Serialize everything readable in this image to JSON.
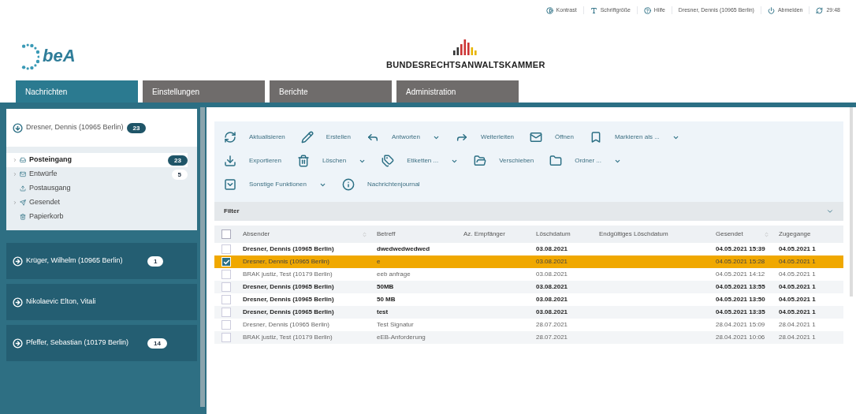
{
  "top_links": [
    {
      "kind": "contrast",
      "label": "Kontrast"
    },
    {
      "kind": "font",
      "label": "Schriftgröße"
    },
    {
      "kind": "help",
      "label": "Hilfe"
    },
    {
      "kind": "user",
      "label": "Dresner, Dennis (10965 Berlin)"
    },
    {
      "kind": "logout",
      "label": "Abmelden"
    },
    {
      "kind": "timer",
      "label": "29:48"
    }
  ],
  "logo": {
    "text": "beA"
  },
  "brand": {
    "text": "BUNDESRECHTSANWALTSKAMMER"
  },
  "tabs": [
    {
      "label": "Nachrichten",
      "selected": true
    },
    {
      "label": "Einstellungen",
      "selected": false
    },
    {
      "label": "Berichte",
      "selected": false
    },
    {
      "label": "Administration",
      "selected": false
    }
  ],
  "accounts": [
    {
      "name": "Dresner, Dennis (10965 Berlin)",
      "count": "23",
      "expanded": true,
      "folders": [
        {
          "kind": "inbox",
          "label": "Posteingang",
          "selected": true,
          "expandable": true,
          "count": "23"
        },
        {
          "kind": "drafts",
          "label": "Entwürfe",
          "selected": false,
          "expandable": true,
          "count": "5"
        },
        {
          "kind": "outbox",
          "label": "Postausgang",
          "selected": false,
          "expandable": false
        },
        {
          "kind": "sent",
          "label": "Gesendet",
          "selected": false,
          "expandable": true
        },
        {
          "kind": "trash",
          "label": "Papierkorb",
          "selected": false,
          "expandable": false
        }
      ]
    },
    {
      "name": "Krüger, Wilhelm (10965 Berlin)",
      "count": "1",
      "expanded": false
    },
    {
      "name": "Nikolaevic Elton, Vitali",
      "expanded": false
    },
    {
      "name": "Pfeffer, Sebastian (10179 Berlin)",
      "count": "14",
      "expanded": false
    }
  ],
  "toolbar": [
    [
      {
        "kind": "refresh",
        "label": "Aktualisieren",
        "dropdown": false
      },
      {
        "kind": "create",
        "label": "Erstellen",
        "dropdown": false
      },
      {
        "kind": "reply",
        "label": "Antworten",
        "dropdown": true
      },
      {
        "kind": "forward",
        "label": "Weiterleiten",
        "dropdown": false
      },
      {
        "kind": "open",
        "label": "Öffnen",
        "dropdown": false
      },
      {
        "kind": "mark",
        "label": "Markieren als ...",
        "dropdown": true
      }
    ],
    [
      {
        "kind": "export",
        "label": "Exportieren",
        "dropdown": false
      },
      {
        "kind": "delete",
        "label": "Löschen",
        "dropdown": true
      },
      {
        "kind": "labels",
        "label": "Etiketten ...",
        "dropdown": true
      },
      {
        "kind": "move",
        "label": "Verschieben",
        "dropdown": false
      },
      {
        "kind": "folder",
        "label": "Ordner ...",
        "dropdown": true
      }
    ],
    [
      {
        "kind": "more",
        "label": "Sonstige Funktionen",
        "dropdown": true
      },
      {
        "kind": "journal",
        "label": "Nachrichtenjournal",
        "dropdown": false
      }
    ]
  ],
  "filter": {
    "label": "Filter"
  },
  "table": {
    "select_all": {
      "checked": false
    },
    "columns": [
      {
        "label": "Absender",
        "sortable": true
      },
      {
        "label": "Betreff",
        "sortable": false
      },
      {
        "label": "Az. Empfänger",
        "sortable": false
      },
      {
        "label": "Löschdatum",
        "sortable": false
      },
      {
        "label": "Endgültiges Löschdatum",
        "sortable": false
      },
      {
        "label": "Gesendet",
        "sortable": true
      },
      {
        "label": "Zugegange",
        "sortable": false
      }
    ],
    "rows": [
      {
        "selected": false,
        "unread": true,
        "cells": [
          "Dresner, Dennis (10965 Berlin)",
          "dwedwedwedwed",
          "",
          "03.08.2021",
          "",
          "04.05.2021 15:39",
          "04.05.2021 1"
        ]
      },
      {
        "selected": true,
        "unread": false,
        "cells": [
          "Dresner, Dennis (10965 Berlin)",
          "e",
          "",
          "03.08.2021",
          "",
          "04.05.2021 15:28",
          "04.05.2021 1"
        ]
      },
      {
        "selected": false,
        "unread": false,
        "cells": [
          "BRAK justiz, Test (10179 Berlin)",
          "eeb anfrage",
          "",
          "03.08.2021",
          "",
          "04.05.2021 14:12",
          "04.05.2021 1"
        ]
      },
      {
        "selected": false,
        "unread": true,
        "cells": [
          "Dresner, Dennis (10965 Berlin)",
          "50MB",
          "",
          "03.08.2021",
          "",
          "04.05.2021 13:55",
          "04.05.2021 1"
        ]
      },
      {
        "selected": false,
        "unread": true,
        "cells": [
          "Dresner, Dennis (10965 Berlin)",
          "50 MB",
          "",
          "03.08.2021",
          "",
          "04.05.2021 13:50",
          "04.05.2021 1"
        ]
      },
      {
        "selected": false,
        "unread": true,
        "cells": [
          "Dresner, Dennis (10965 Berlin)",
          "test",
          "",
          "03.08.2021",
          "",
          "04.05.2021 13:35",
          "04.05.2021 1"
        ]
      },
      {
        "selected": false,
        "unread": false,
        "cells": [
          "Dresner, Dennis (10965 Berlin)",
          "Test Signatur",
          "",
          "28.07.2021",
          "",
          "28.04.2021 15:09",
          "28.04.2021 1"
        ]
      },
      {
        "selected": false,
        "unread": false,
        "cells": [
          "BRAK justiz, Test (10179 Berlin)",
          "eEB-Anforderung",
          "",
          "28.07.2021",
          "",
          "28.04.2021 10:06",
          "28.04.2021 1"
        ]
      }
    ]
  }
}
